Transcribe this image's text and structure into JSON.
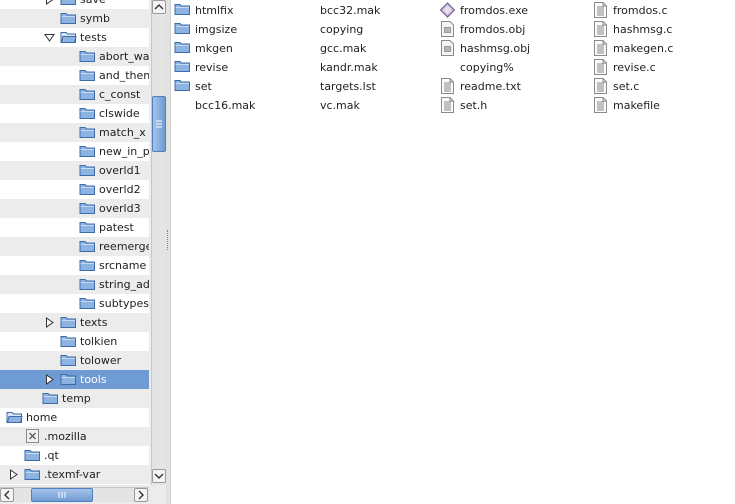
{
  "tree": {
    "rows": [
      {
        "label": "save",
        "depth": 3,
        "expander": "right",
        "icon": "folder"
      },
      {
        "label": "symb",
        "depth": 3,
        "expander": "none",
        "icon": "folder"
      },
      {
        "label": "tests",
        "depth": 3,
        "expander": "down",
        "icon": "folder-open"
      },
      {
        "label": "abort_wa",
        "depth": 4,
        "expander": "none",
        "icon": "folder"
      },
      {
        "label": "and_then",
        "depth": 4,
        "expander": "none",
        "icon": "folder"
      },
      {
        "label": "c_const",
        "depth": 4,
        "expander": "none",
        "icon": "folder"
      },
      {
        "label": "clswide",
        "depth": 4,
        "expander": "none",
        "icon": "folder"
      },
      {
        "label": "match_x",
        "depth": 4,
        "expander": "none",
        "icon": "folder"
      },
      {
        "label": "new_in_p",
        "depth": 4,
        "expander": "none",
        "icon": "folder"
      },
      {
        "label": "overld1",
        "depth": 4,
        "expander": "none",
        "icon": "folder"
      },
      {
        "label": "overld2",
        "depth": 4,
        "expander": "none",
        "icon": "folder"
      },
      {
        "label": "overld3",
        "depth": 4,
        "expander": "none",
        "icon": "folder"
      },
      {
        "label": "patest",
        "depth": 4,
        "expander": "none",
        "icon": "folder"
      },
      {
        "label": "reemerge",
        "depth": 4,
        "expander": "none",
        "icon": "folder"
      },
      {
        "label": "srcname",
        "depth": 4,
        "expander": "none",
        "icon": "folder"
      },
      {
        "label": "string_ad",
        "depth": 4,
        "expander": "none",
        "icon": "folder"
      },
      {
        "label": "subtypes",
        "depth": 4,
        "expander": "none",
        "icon": "folder"
      },
      {
        "label": "texts",
        "depth": 3,
        "expander": "right",
        "icon": "folder"
      },
      {
        "label": "tolkien",
        "depth": 3,
        "expander": "none",
        "icon": "folder"
      },
      {
        "label": "tolower",
        "depth": 3,
        "expander": "none",
        "icon": "folder"
      },
      {
        "label": "tools",
        "depth": 3,
        "expander": "right",
        "icon": "folder",
        "selected": true
      },
      {
        "label": "temp",
        "depth": 2,
        "expander": "none",
        "icon": "folder"
      },
      {
        "label": "home",
        "depth": 0,
        "expander": "none",
        "icon": "folder-open"
      },
      {
        "label": ".mozilla",
        "depth": 1,
        "expander": "none",
        "icon": "broken-file"
      },
      {
        "label": ".qt",
        "depth": 1,
        "expander": "none",
        "icon": "folder"
      },
      {
        "label": ".texmf-var",
        "depth": 1,
        "expander": "right",
        "icon": "folder"
      }
    ]
  },
  "files": {
    "columns": [
      [
        {
          "name": "htmlfix",
          "icon": "folder"
        },
        {
          "name": "imgsize",
          "icon": "folder"
        },
        {
          "name": "mkgen",
          "icon": "folder"
        },
        {
          "name": "revise",
          "icon": "folder"
        },
        {
          "name": "set",
          "icon": "folder"
        },
        {
          "name": "bcc16.mak",
          "icon": "none"
        }
      ],
      [
        {
          "name": "bcc32.mak",
          "icon": "none"
        },
        {
          "name": "copying",
          "icon": "none"
        },
        {
          "name": "gcc.mak",
          "icon": "none"
        },
        {
          "name": "kandr.mak",
          "icon": "none"
        },
        {
          "name": "targets.lst",
          "icon": "none"
        },
        {
          "name": "vc.mak",
          "icon": "none"
        }
      ],
      [
        {
          "name": "fromdos.exe",
          "icon": "executable"
        },
        {
          "name": "fromdos.obj",
          "icon": "binary"
        },
        {
          "name": "hashmsg.obj",
          "icon": "binary"
        },
        {
          "name": "copying%",
          "icon": "none"
        },
        {
          "name": "readme.txt",
          "icon": "text"
        },
        {
          "name": "set.h",
          "icon": "text"
        }
      ],
      [
        {
          "name": "fromdos.c",
          "icon": "text"
        },
        {
          "name": "hashmsg.c",
          "icon": "text"
        },
        {
          "name": "makegen.c",
          "icon": "text"
        },
        {
          "name": "revise.c",
          "icon": "text"
        },
        {
          "name": "set.c",
          "icon": "text"
        },
        {
          "name": "makefile",
          "icon": "text"
        }
      ]
    ]
  },
  "colors": {
    "selection": "#6f9bd4",
    "folder_fill": "#8db3e2",
    "folder_stroke": "#3d6ba8",
    "alt_row": "#ececec"
  }
}
